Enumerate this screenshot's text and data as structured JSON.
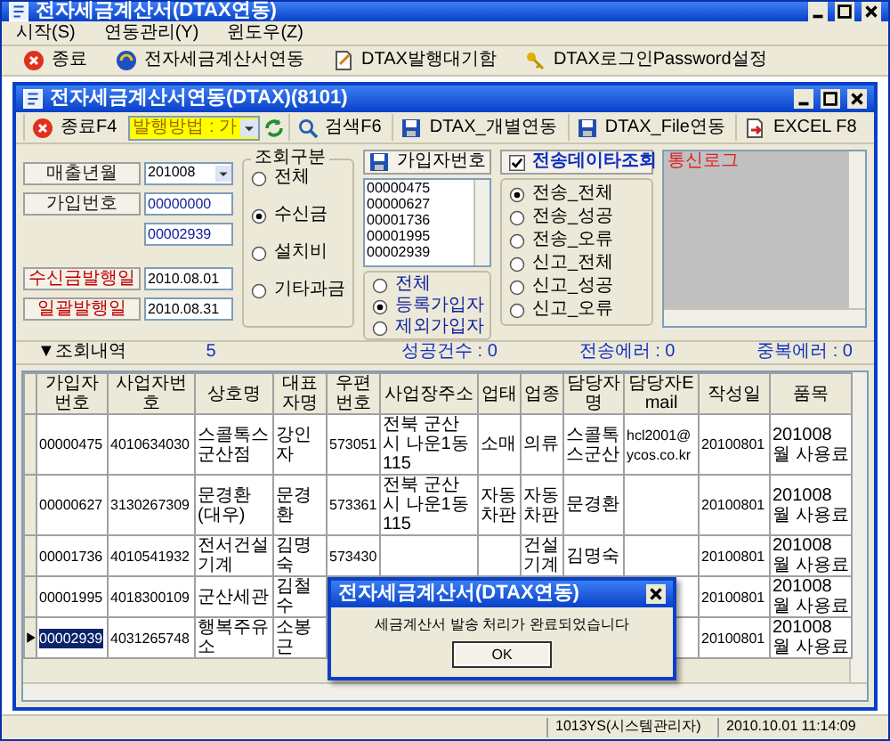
{
  "window": {
    "title": "전자세금계산서(DTAX연동)"
  },
  "menu": [
    {
      "label": "시작(S)"
    },
    {
      "label": "연동관리(Y)"
    },
    {
      "label": "윈도우(Z)"
    }
  ],
  "toolbar": [
    {
      "kind": "exit",
      "label": "종료"
    },
    {
      "kind": "sync",
      "label": "전자세금계산서연동"
    },
    {
      "kind": "document",
      "label": "DTAX발행대기함"
    },
    {
      "kind": "key",
      "label": "DTAX로그인Password설정"
    }
  ],
  "child_window": {
    "title": "전자세금계산서연동(DTAX)(8101)",
    "toolbar": [
      {
        "kind": "exit",
        "label": "종료F4"
      },
      {
        "kind": "combo",
        "value": "발행방법 : 가"
      },
      {
        "kind": "refresh"
      },
      {
        "kind": "search",
        "label": "검색F6"
      },
      {
        "kind": "save",
        "label": "DTAX_개별연동"
      },
      {
        "kind": "save",
        "label": "DTAX_File연동"
      },
      {
        "kind": "export",
        "label": "EXCEL F8"
      }
    ],
    "fields": [
      {
        "kind": "combo",
        "label": "매출년월",
        "values": [
          "201008"
        ]
      },
      {
        "kind": "text",
        "label": "가입번호",
        "values": [
          "00000000",
          "00002939"
        ]
      },
      {
        "kind": "date",
        "label": "수신금발행일",
        "values": [
          "2010.08.01"
        ]
      },
      {
        "kind": "date",
        "label": "일괄발행일",
        "values": [
          "2010.08.31"
        ]
      }
    ],
    "inquiry_type": {
      "title": "조회구분",
      "options": [
        {
          "label": "전체",
          "selected": false
        },
        {
          "label": "수신금",
          "selected": true
        },
        {
          "label": "설치비",
          "selected": false
        },
        {
          "label": "기타과금",
          "selected": false
        }
      ]
    },
    "subscribers": {
      "title": "가입자번호",
      "list": [
        "00000475",
        "00000627",
        "00001736",
        "00001995",
        "00002939"
      ],
      "options": [
        {
          "label": "전체",
          "selected": false
        },
        {
          "label": "등록가입자",
          "selected": true
        },
        {
          "label": "제외가입자",
          "selected": false
        }
      ]
    },
    "transmission": {
      "title": "전송데이타조회",
      "checked": true,
      "options": [
        {
          "label": "전송_전체",
          "selected": true
        },
        {
          "label": "전송_성공",
          "selected": false
        },
        {
          "label": "전송_오류",
          "selected": false
        },
        {
          "label": "신고_전체",
          "selected": false
        },
        {
          "label": "신고_성공",
          "selected": false
        },
        {
          "label": "신고_오류",
          "selected": false
        }
      ]
    },
    "log": {
      "title": "통신로그"
    },
    "summary": {
      "title": "▼조회내역",
      "count": "5",
      "success": "성공건수 : 0",
      "send_errors": "전송에러 : 0",
      "duplicate_errors": "중복에러 : 0"
    },
    "table": {
      "columns": [
        "가입자번호",
        "사업자번호",
        "상호명",
        "대표자명",
        "우편번호",
        "사업장주소",
        "업태",
        "업종",
        "담당자명",
        "담당자Email",
        "작성일",
        "품목"
      ],
      "rows": [
        {
          "selected": false,
          "subscriber_no": "00000475",
          "business_no": "4010634030",
          "company": "스콜톡스 군산점",
          "representative": "강인자",
          "postal_code": "573051",
          "address": "전북 군산시 나운1동 115",
          "business_type": "소매",
          "business_item": "의류",
          "contact": "스콜톡스군산",
          "email": "hcl2001@ycos.co.kr",
          "written_date": "20100801",
          "item": "201008월 사용료"
        },
        {
          "selected": false,
          "subscriber_no": "00000627",
          "business_no": "3130267309",
          "company": "문경환(대우)",
          "representative": "문경환",
          "postal_code": "573361",
          "address": "전북 군산시 나운1동 115",
          "business_type": "자동차판",
          "business_item": "자동차판",
          "contact": "문경환",
          "written_date": "20100801",
          "item": "201008월 사용료"
        },
        {
          "selected": false,
          "subscriber_no": "00001736",
          "business_no": "4010541932",
          "company": "전서건설기계",
          "representative": "김명숙",
          "postal_code": "573430",
          "business_item": "건설기계",
          "contact": "김명숙",
          "written_date": "20100801",
          "item": "201008월 사용료"
        },
        {
          "selected": false,
          "subscriber_no": "00001995",
          "business_no": "4018300109",
          "company": "군산세관",
          "representative": "김철수",
          "written_date": "20100801",
          "item": "201008월 사용료"
        },
        {
          "selected": true,
          "subscriber_no": "00002939",
          "business_no": "4031265748",
          "company": "행복주유소",
          "representative": "소봉근",
          "written_date": "20100801",
          "item": "201008월 사용료"
        }
      ]
    },
    "dialog": {
      "title": "전자세금계산서(DTAX연동)",
      "message": "세금계산서 발송 처리가 완료되었습니다",
      "button": "OK"
    }
  },
  "status_bar": [
    "1013YS(시스템관리자)",
    "2010.10.01 11:14:09"
  ]
}
